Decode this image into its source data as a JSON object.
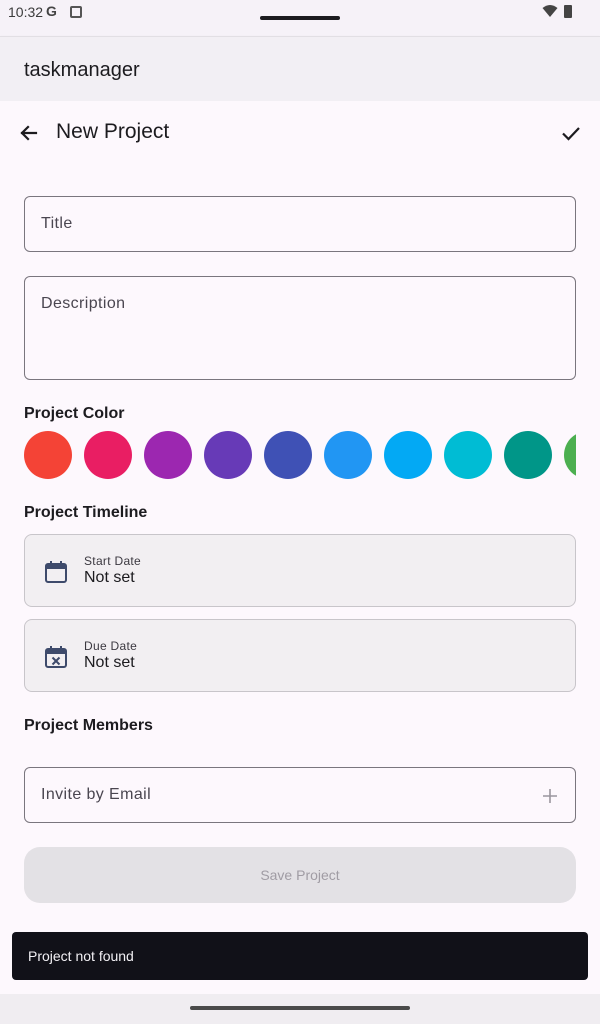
{
  "status_bar": {
    "time": "10:32",
    "g_label": "G"
  },
  "app_bar": {
    "title": "taskmanager"
  },
  "top_bar": {
    "title": "New Project"
  },
  "form": {
    "title_placeholder": "Title",
    "description_placeholder": "Description",
    "color_section_label": "Project Color",
    "colors": [
      "#f44336",
      "#e91e63",
      "#9c27b0",
      "#673ab7",
      "#3f51b5",
      "#2196f3",
      "#03a9f4",
      "#00bcd4",
      "#009688",
      "#4caf50"
    ],
    "timeline_section_label": "Project Timeline",
    "start_date": {
      "label": "Start Date",
      "value": "Not set",
      "icon": "calendar-icon"
    },
    "due_date": {
      "label": "Due Date",
      "value": "Not set",
      "icon": "calendar-cancel-icon"
    },
    "members_section_label": "Project Members",
    "invite_placeholder": "Invite by Email",
    "save_label": "Save Project"
  },
  "snackbar": {
    "message": "Project not found"
  }
}
